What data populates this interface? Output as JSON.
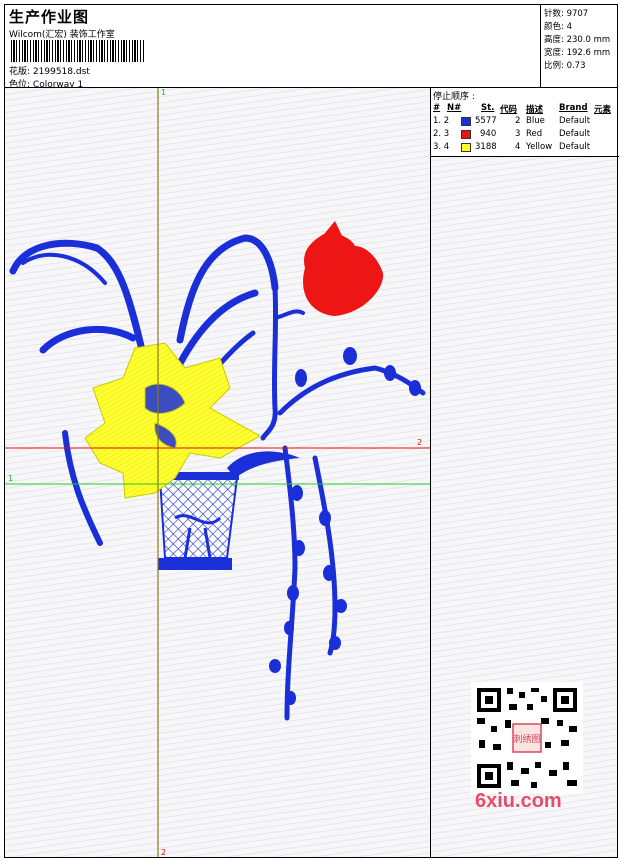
{
  "header": {
    "title": "生产作业图",
    "subtitle": "Wilcom(汇宏) 装饰工作室",
    "design_label": "花版:",
    "design_value": "2199518.dst",
    "colorway_label": "色位:",
    "colorway_value": "Colorway 1"
  },
  "stats": {
    "stitches": "针数: 9707",
    "colors": "颜色: 4",
    "height": "高度: 230.0 mm",
    "width": "宽度: 192.6 mm",
    "scale": "比例: 0.73"
  },
  "stop_sequence": {
    "title": "停止顺序 :",
    "headers": [
      "#",
      "N#",
      "St.",
      "代码",
      "描述",
      "Brand",
      "元素"
    ],
    "rows": [
      {
        "idx": "1. 2",
        "color": "#1f2fd6",
        "stitches": "5577",
        "code": "2",
        "desc": "Blue",
        "brand": "Default"
      },
      {
        "idx": "2. 3",
        "color": "#ee1111",
        "stitches": "940",
        "code": "3",
        "desc": "Red",
        "brand": "Default"
      },
      {
        "idx": "3. 4",
        "color": "#ffff22",
        "stitches": "3188",
        "code": "4",
        "desc": "Yellow",
        "brand": "Default"
      }
    ]
  },
  "axes": {
    "v_top": "1",
    "v_bottom": "2",
    "h_red_right": "2",
    "h_green_left": "1"
  },
  "colors": {
    "blue": "#1a2fd8",
    "red": "#ee1515",
    "yellow": "#f2f21e",
    "axis_vertical": "#8a7a1a",
    "axis_red": "#e01010",
    "axis_green": "#22cc22"
  },
  "watermark": {
    "brand": "6xiu.com",
    "seal": "刺绣图"
  }
}
